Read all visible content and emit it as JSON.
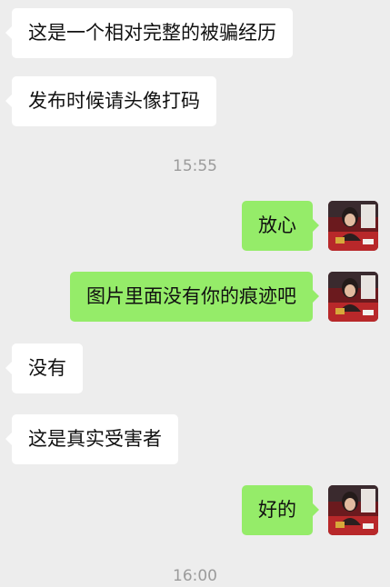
{
  "messages": [
    {
      "type": "in",
      "text": "这是一个相对完整的被骗经历"
    },
    {
      "type": "in",
      "text": "发布时候请头像打码"
    },
    {
      "type": "time",
      "text": "15:55"
    },
    {
      "type": "out",
      "text": "放心"
    },
    {
      "type": "out",
      "text": "图片里面没有你的痕迹吧"
    },
    {
      "type": "in",
      "text": "没有"
    },
    {
      "type": "in",
      "text": "这是真实受害者"
    },
    {
      "type": "out",
      "text": "好的"
    },
    {
      "type": "time",
      "text": "16:00"
    }
  ],
  "colors": {
    "background": "#ededed",
    "incoming_bubble": "#ffffff",
    "outgoing_bubble": "#95ec69",
    "timestamp_text": "#9b9b9b"
  },
  "avatar": {
    "icon": "user-avatar-photo"
  }
}
